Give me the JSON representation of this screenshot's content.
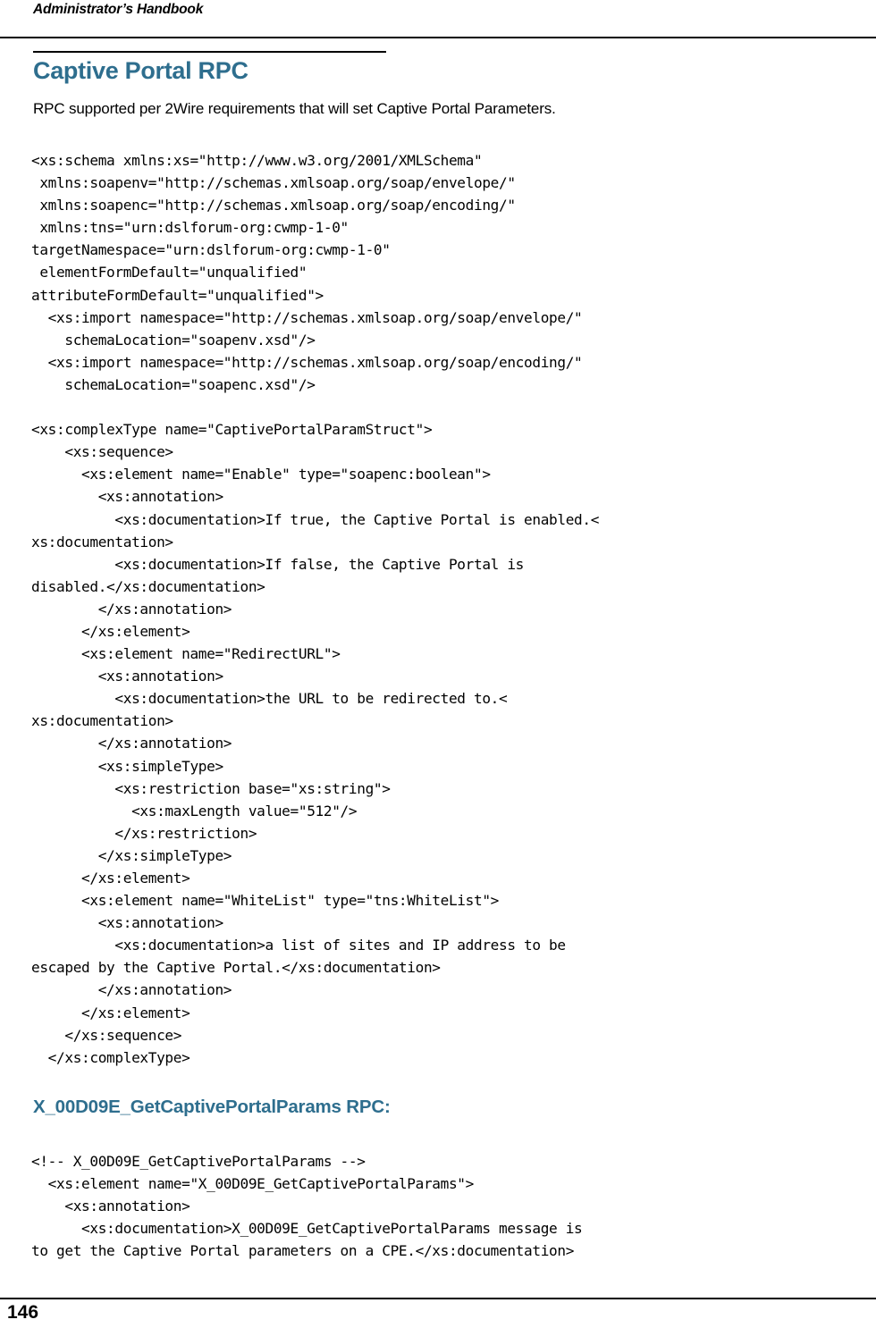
{
  "page": {
    "running_header": "Administrator’s Handbook",
    "page_number": "146",
    "accent_color": "#2E6E8E",
    "text_color": "#000000",
    "background_color": "#FFFFFF"
  },
  "sections": {
    "heading1": "Captive Portal RPC",
    "intro_paragraph": "RPC supported per 2Wire requirements that will set Captive Portal Parameters.",
    "heading2": "X_00D09E_GetCaptivePortalParams RPC:"
  },
  "code": {
    "schema_block": "<xs:schema xmlns:xs=\"http://www.w3.org/2001/XMLSchema\"\n xmlns:soapenv=\"http://schemas.xmlsoap.org/soap/envelope/\"\n xmlns:soapenc=\"http://schemas.xmlsoap.org/soap/encoding/\"\n xmlns:tns=\"urn:dslforum-org:cwmp-1-0\"\ntargetNamespace=\"urn:dslforum-org:cwmp-1-0\"\n elementFormDefault=\"unqualified\"\nattributeFormDefault=\"unqualified\">\n  <xs:import namespace=\"http://schemas.xmlsoap.org/soap/envelope/\"\n    schemaLocation=\"soapenv.xsd\"/>\n  <xs:import namespace=\"http://schemas.xmlsoap.org/soap/encoding/\"\n    schemaLocation=\"soapenc.xsd\"/>\n\n<xs:complexType name=\"CaptivePortalParamStruct\">\n    <xs:sequence>\n      <xs:element name=\"Enable\" type=\"soapenc:boolean\">\n        <xs:annotation>\n          <xs:documentation>If true, the Captive Portal is enabled.<\nxs:documentation>\n          <xs:documentation>If false, the Captive Portal is\ndisabled.</xs:documentation>\n        </xs:annotation>\n      </xs:element>\n      <xs:element name=\"RedirectURL\">\n        <xs:annotation>\n          <xs:documentation>the URL to be redirected to.<\nxs:documentation>\n        </xs:annotation>\n        <xs:simpleType>\n          <xs:restriction base=\"xs:string\">\n            <xs:maxLength value=\"512\"/>\n          </xs:restriction>\n        </xs:simpleType>\n      </xs:element>\n      <xs:element name=\"WhiteList\" type=\"tns:WhiteList\">\n        <xs:annotation>\n          <xs:documentation>a list of sites and IP address to be\nescaped by the Captive Portal.</xs:documentation>\n        </xs:annotation>\n      </xs:element>\n    </xs:sequence>\n  </xs:complexType>",
    "getparams_block": "<!-- X_00D09E_GetCaptivePortalParams -->\n  <xs:element name=\"X_00D09E_GetCaptivePortalParams\">\n    <xs:annotation>\n      <xs:documentation>X_00D09E_GetCaptivePortalParams message is\nto get the Captive Portal parameters on a CPE.</xs:documentation>"
  }
}
